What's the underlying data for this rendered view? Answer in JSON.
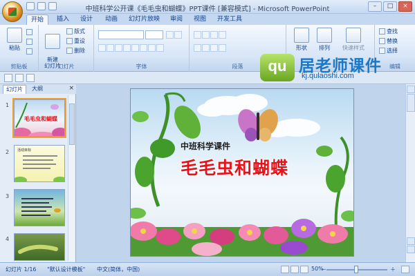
{
  "window": {
    "title": "中班科学公开课《毛毛虫和蝴蝶》PPT课件 [兼容模式] - Microsoft PowerPoint"
  },
  "tabs": [
    "开始",
    "插入",
    "设计",
    "动画",
    "幻灯片放映",
    "审阅",
    "视图",
    "开发工具"
  ],
  "ribbon": {
    "clipboard": {
      "paste": "粘贴",
      "label": "剪贴板"
    },
    "slides": {
      "new_slide": "新建\n幻灯片",
      "layout": "版式",
      "reset": "重设",
      "delete": "删除",
      "label": "幻灯片"
    },
    "font": {
      "label": "字体"
    },
    "paragraph": {
      "label": "段落"
    },
    "drawing": {
      "shape": "形状",
      "arrange": "排列",
      "quick_style": "快速样式"
    },
    "editing": {
      "find": "查找",
      "replace": "替换",
      "select": "选择",
      "label": "编辑"
    }
  },
  "watermark": {
    "logo_text": "qu",
    "brand": "居老师课件",
    "url": "kj.qulaoshi.com"
  },
  "left_pane": {
    "tabs": [
      "幻灯片",
      "大纲"
    ],
    "close": "×",
    "thumbnails": [
      {
        "num": "1",
        "text": "毛毛虫和蝴蝶"
      },
      {
        "num": "2",
        "text": "活动目标"
      },
      {
        "num": "3",
        "text": ""
      },
      {
        "num": "4",
        "text": ""
      }
    ]
  },
  "slide": {
    "subtitle": "中班科学课件",
    "title": "毛毛虫和蝴蝶"
  },
  "status": {
    "slide_info": "幻灯片 1/16",
    "theme": "\"默认设计模板\"",
    "language": "中文(简体，中国)",
    "zoom": "50%",
    "zoom_minus": "－",
    "zoom_plus": "＋"
  },
  "window_controls": {
    "minimize": "–",
    "maximize": "□",
    "close": "×"
  },
  "colors": {
    "ribbon_blue": "#15428b",
    "title_red": "#e5141c",
    "selection_orange": "#f0a030"
  }
}
